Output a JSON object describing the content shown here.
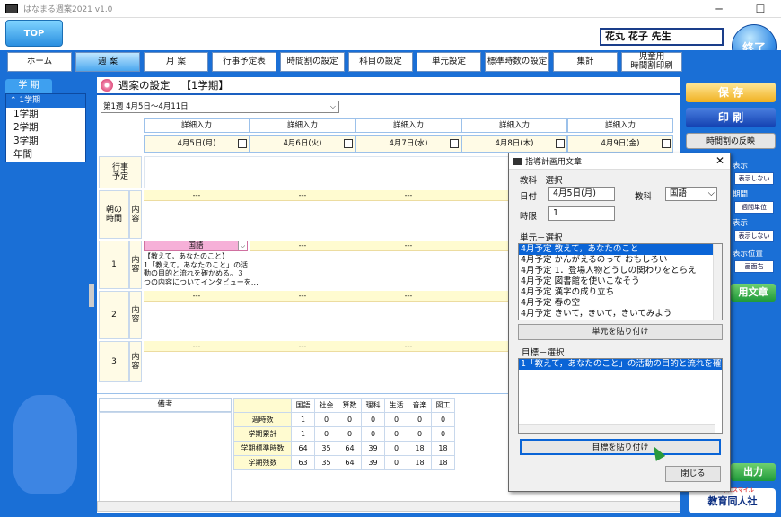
{
  "app": {
    "title": "はなまる週案2021 v1.0"
  },
  "header": {
    "top_button": "TOP",
    "teacher_name": "花丸 花子 先生",
    "exit_button": "終了"
  },
  "nav": [
    "ホーム",
    "週 案",
    "月 案",
    "行事予定表",
    "時間割の設定",
    "科目の設定",
    "単元設定",
    "標準時数の設定",
    "集計",
    "児童用\n時間割印刷"
  ],
  "term_panel": {
    "title": "学 期",
    "selected": "1学期",
    "items": [
      "1学期",
      "2学期",
      "3学期",
      "年間"
    ]
  },
  "section": {
    "title": "週案の設定",
    "term": "【1学期】",
    "week": "第1週 4月5日～4月11日"
  },
  "grid": {
    "col_header": "詳細入力",
    "dates": [
      "4月5日(月)",
      "4月6日(火)",
      "4月7日(水)",
      "4月8日(木)",
      "4月9日(金)"
    ],
    "rows": {
      "event": "行事\n予定",
      "morning": "朝の\n時間",
      "content": "内\n容",
      "p1": "1",
      "p2": "2",
      "p3": "3"
    },
    "dash": "---",
    "p1_subject": "国語",
    "p1_content": "【教えて，あなたのこと】\n1「教えて，あなたのこと」の活\n動の目的と流れを確かめる。３\nつの内容についてインタビューを…"
  },
  "bottom": {
    "notes_label": "備考",
    "subjects": [
      "国語",
      "社会",
      "算数",
      "理科",
      "生活",
      "音楽",
      "図工"
    ],
    "rows": [
      {
        "label": "週時数",
        "values": [
          "1",
          "0",
          "0",
          "0",
          "0",
          "0",
          "0"
        ]
      },
      {
        "label": "学期累計",
        "values": [
          "1",
          "0",
          "0",
          "0",
          "0",
          "0",
          "0"
        ]
      },
      {
        "label": "学期標準時数",
        "values": [
          "64",
          "35",
          "64",
          "39",
          "0",
          "18",
          "18"
        ]
      },
      {
        "label": "学期残数",
        "values": [
          "63",
          "35",
          "64",
          "39",
          "0",
          "18",
          "18"
        ]
      }
    ]
  },
  "right_panel": {
    "save": "保 存",
    "print": "印 刷",
    "reflect": "時間割の反映",
    "show1": "表示",
    "hide1": "表示しない",
    "period_label": "期間",
    "unit_label": "週間単位",
    "show2": "表示",
    "hide2": "表示しない",
    "pos_label": "表示位置",
    "pos_value": "画面右",
    "phrases": "用文章",
    "output": "出力"
  },
  "modal": {
    "title": "指導計画用文章",
    "subject_section": "教科－選択",
    "date_label": "日付",
    "date_value": "4月5日(月)",
    "subject_label": "教科",
    "subject_value": "国語",
    "period_label": "時限",
    "period_value": "1",
    "unit_section": "単元－選択",
    "units": [
      "4月予定 教えて，あなたのこと",
      "4月予定 かんがえるのって おもしろい",
      "4月予定 1．登場人物どうしの関わりをとらえ",
      "4月予定 図書館を使いこなそう",
      "4月予定 漢字の成り立ち",
      "4月予定 春の空",
      "4月予定 きいて，きいて，きいてみよう"
    ],
    "paste_unit": "単元を貼り付け",
    "goal_section": "目標－選択",
    "goals": [
      "1「教えて，あなたのこと」の活動の目的と流れを確"
    ],
    "paste_goal": "目標を貼り付け",
    "close": "閉じる"
  },
  "logo": {
    "tagline": "みんなにスマイル",
    "name": "教育同人社"
  }
}
